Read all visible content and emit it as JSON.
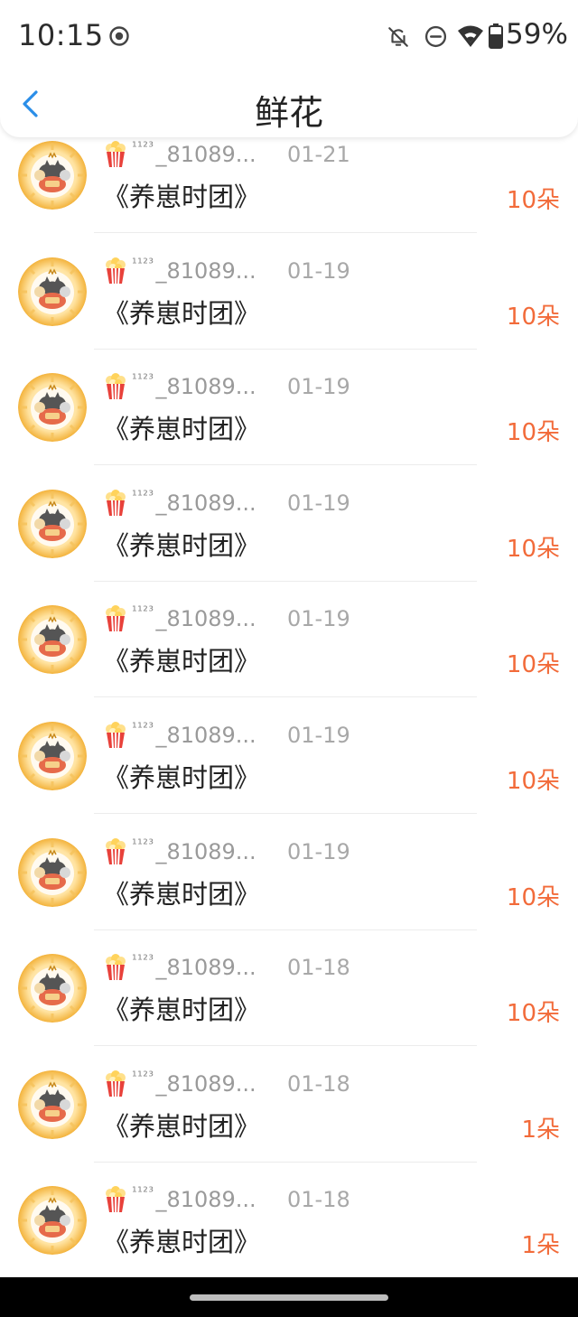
{
  "status_bar": {
    "time": "10:15",
    "battery": "59%"
  },
  "nav": {
    "title": "鲜花"
  },
  "rows": [
    {
      "superscript": "¹¹²³",
      "user_name": "_81089...",
      "date": "01-21",
      "book_title": "《养崽时团》",
      "count": "10朵"
    },
    {
      "superscript": "¹¹²³",
      "user_name": "_81089...",
      "date": "01-19",
      "book_title": "《养崽时团》",
      "count": "10朵"
    },
    {
      "superscript": "¹¹²³",
      "user_name": "_81089...",
      "date": "01-19",
      "book_title": "《养崽时团》",
      "count": "10朵"
    },
    {
      "superscript": "¹¹²³",
      "user_name": "_81089...",
      "date": "01-19",
      "book_title": "《养崽时团》",
      "count": "10朵"
    },
    {
      "superscript": "¹¹²³",
      "user_name": "_81089...",
      "date": "01-19",
      "book_title": "《养崽时团》",
      "count": "10朵"
    },
    {
      "superscript": "¹¹²³",
      "user_name": "_81089...",
      "date": "01-19",
      "book_title": "《养崽时团》",
      "count": "10朵"
    },
    {
      "superscript": "¹¹²³",
      "user_name": "_81089...",
      "date": "01-19",
      "book_title": "《养崽时团》",
      "count": "10朵"
    },
    {
      "superscript": "¹¹²³",
      "user_name": "_81089...",
      "date": "01-18",
      "book_title": "《养崽时团》",
      "count": "10朵"
    },
    {
      "superscript": "¹¹²³",
      "user_name": "_81089...",
      "date": "01-18",
      "book_title": "《养崽时团》",
      "count": "1朵"
    },
    {
      "superscript": "¹¹²³",
      "user_name": "_81089...",
      "date": "01-18",
      "book_title": "《养崽时团》",
      "count": "1朵"
    }
  ],
  "icons": {
    "back": "chevron-left-icon",
    "row_badge": "popcorn-icon",
    "avatar": "cat-avatar"
  },
  "colors": {
    "accent_blue": "#2a8ee8",
    "count_orange": "#f26b3a",
    "meta_gray": "#a8a8a8"
  }
}
